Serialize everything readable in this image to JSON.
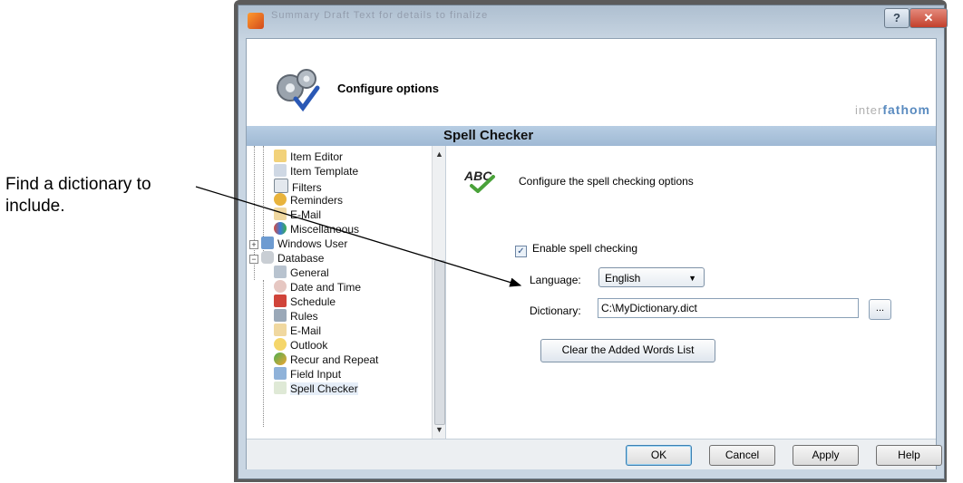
{
  "callout": {
    "line1": "Find a dictionary to",
    "line2": "include."
  },
  "window": {
    "blurred_title": "Summary    Draft Text for details to finalize"
  },
  "header": {
    "title": "Configure options",
    "brand_prefix": "inter",
    "brand_suffix": "fathom"
  },
  "section_title": "Spell Checker",
  "tree": {
    "items": [
      "Item Editor",
      "Item Template",
      "Filters",
      "Reminders",
      "E-Mail",
      "Miscellaneous",
      "Windows User",
      "Database",
      "General",
      "Date and Time",
      "Schedule",
      "Rules",
      "E-Mail",
      "Outlook",
      "Recur and Repeat",
      "Field Input",
      "Spell Checker"
    ],
    "selected": "Spell Checker"
  },
  "panel": {
    "abc_text": "ABC",
    "description": "Configure the spell checking options",
    "enable_label": "Enable spell checking",
    "enable_checked": true,
    "language_label": "Language:",
    "language_value": "English",
    "dictionary_label": "Dictionary:",
    "dictionary_value": "C:\\MyDictionary.dict",
    "browse_label": "...",
    "clear_label": "Clear the Added Words List"
  },
  "footer": {
    "ok": "OK",
    "cancel": "Cancel",
    "apply": "Apply",
    "help": "Help"
  },
  "colors": {
    "accent": "#9fb9d4",
    "frame": "#c9d6e3",
    "brand": "#5a8bc0"
  }
}
